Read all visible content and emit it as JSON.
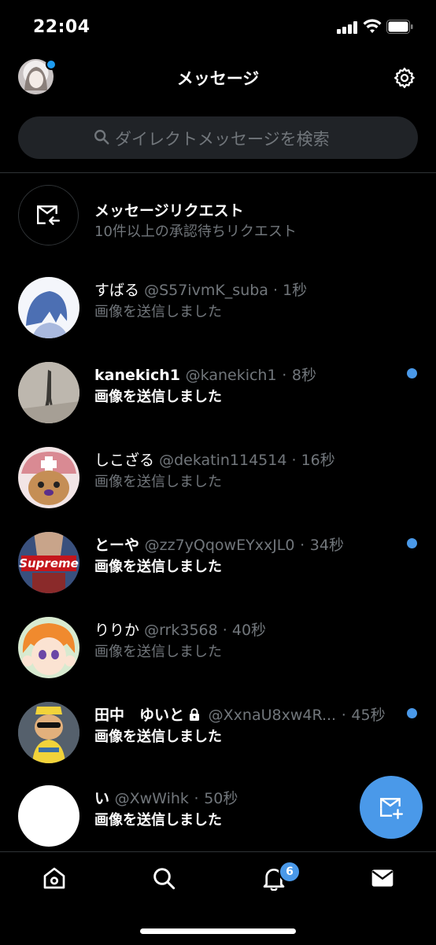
{
  "status_bar": {
    "time": "22:04"
  },
  "header": {
    "title": "メッセージ"
  },
  "search": {
    "placeholder": "ダイレクトメッセージを検索"
  },
  "message_requests": {
    "title": "メッセージリクエスト",
    "subtitle": "10件以上の承認待ちリクエスト"
  },
  "conversations": [
    {
      "name": "すばる",
      "handle": "@S57ivmK_suba",
      "time": "1秒",
      "message": "画像を送信しました",
      "unread": false,
      "protected": false
    },
    {
      "name": "kanekich1",
      "handle": "@kanekich1",
      "time": "8秒",
      "message": "画像を送信しました",
      "unread": true,
      "protected": false
    },
    {
      "name": "しこざる",
      "handle": "@dekatin114514",
      "time": "16秒",
      "message": "画像を送信しました",
      "unread": false,
      "protected": false
    },
    {
      "name": "とーや",
      "handle": "@zz7yQqowEYxxJL0",
      "time": "34秒",
      "message": "画像を送信しました",
      "unread": true,
      "protected": false
    },
    {
      "name": "りりか",
      "handle": "@rrk3568",
      "time": "40秒",
      "message": "画像を送信しました",
      "unread": false,
      "protected": false
    },
    {
      "name": "田中　ゆいと",
      "handle": "@XxnaU8xw4R...",
      "time": "45秒",
      "message": "画像を送信しました",
      "unread": true,
      "protected": true
    },
    {
      "name": "い",
      "handle": "@XwWihk",
      "time": "50秒",
      "message": "画像を送信しました",
      "unread": true,
      "protected": false
    }
  ],
  "tabbar": {
    "notifications_badge": "6"
  },
  "colors": {
    "accent": "#4a99e9",
    "muted_text": "#71767b",
    "background": "#000000"
  }
}
